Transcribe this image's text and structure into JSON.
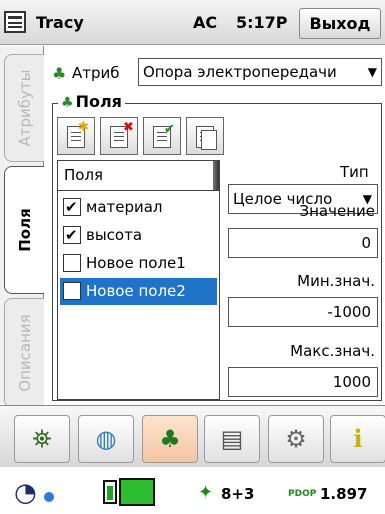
{
  "titlebar": {
    "app_title": "Tracy",
    "status_ac": "AC",
    "time": "5:17P",
    "exit_label": "Выход"
  },
  "tabs": [
    {
      "label": "Атрибуты",
      "active": false
    },
    {
      "label": "Поля",
      "active": true
    },
    {
      "label": "Описания",
      "active": false
    }
  ],
  "attribute": {
    "label": "Атриб",
    "selected": "Опора электропередачи"
  },
  "fields_group": {
    "title": "Поля",
    "toolbar": [
      "add-field",
      "delete-field",
      "check-field",
      "copy-field"
    ],
    "list_header": "Поля",
    "items": [
      {
        "label": "материал",
        "checked": true,
        "selected": false
      },
      {
        "label": "высота",
        "checked": true,
        "selected": false
      },
      {
        "label": "Новое поле1",
        "checked": false,
        "selected": false
      },
      {
        "label": "Новое поле2",
        "checked": false,
        "selected": true
      }
    ]
  },
  "properties": {
    "type_label": "Тип",
    "type_value": "Целое число",
    "value_label": "Значение",
    "value": "0",
    "min_label": "Мин.знач.",
    "min_value": "-1000",
    "max_label": "Макс.знач.",
    "max_value": "1000"
  },
  "bottom_toolbar": [
    "survey-icon",
    "globe-icon",
    "tree-icon",
    "document-icon",
    "gear-icon",
    "info-icon"
  ],
  "status": {
    "satellites": "8+3",
    "pdop_label": "PDOP",
    "pdop_value": "1.897"
  },
  "colors": {
    "selection": "#1f73c9",
    "battery": "#2ebd2e"
  }
}
